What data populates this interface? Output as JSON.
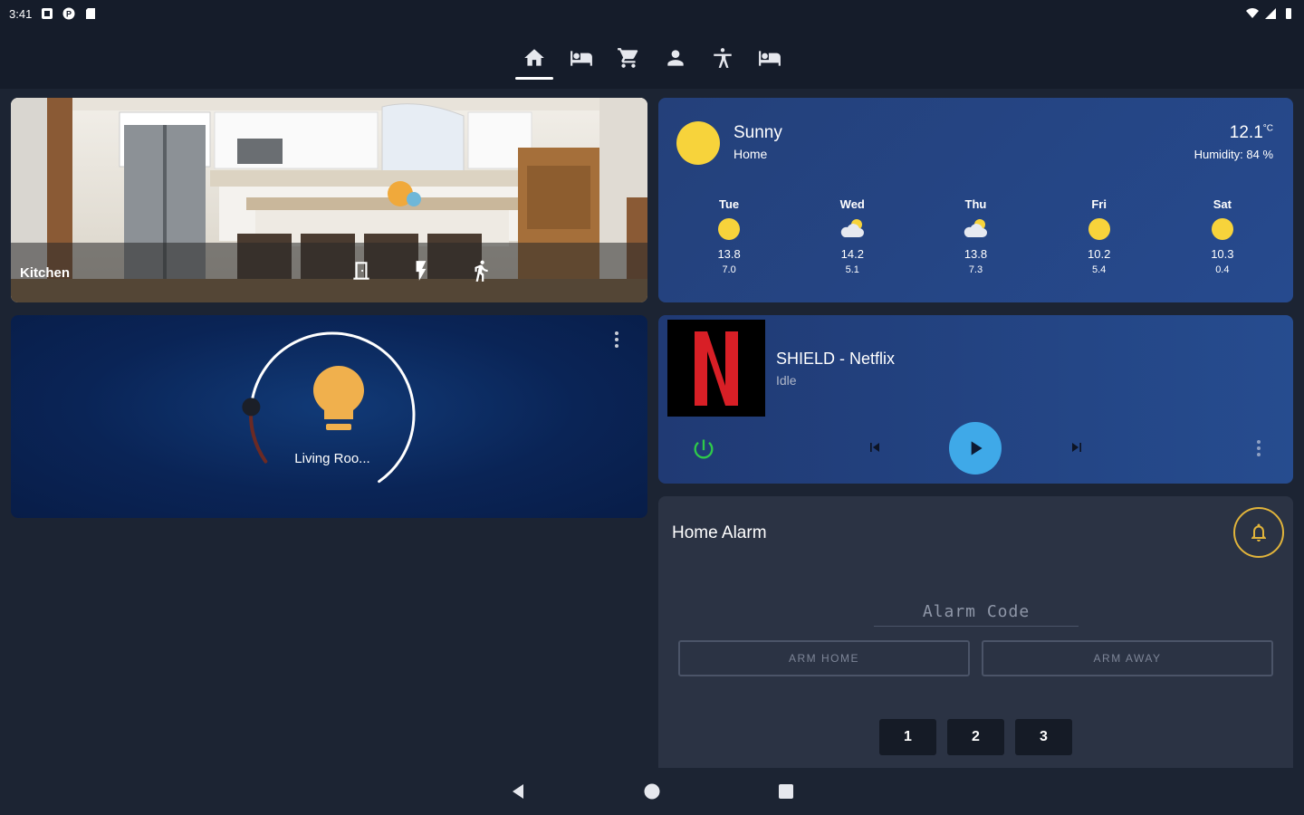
{
  "status_bar": {
    "time": "3:41"
  },
  "nav_tabs": [
    {
      "icon": "home-icon",
      "active": true
    },
    {
      "icon": "bed-icon",
      "active": false
    },
    {
      "icon": "cart-icon",
      "active": false
    },
    {
      "icon": "person-icon",
      "active": false
    },
    {
      "icon": "figure-icon",
      "active": false
    },
    {
      "icon": "bed-icon",
      "active": false
    }
  ],
  "kitchen": {
    "title": "Kitchen",
    "icons": [
      "door-icon",
      "flash-icon",
      "walk-icon"
    ]
  },
  "weather": {
    "condition": "Sunny",
    "location": "Home",
    "temperature": "12.1",
    "unit": "°C",
    "humidity": "Humidity: 84 %",
    "forecast": [
      {
        "day": "Tue",
        "icon": "sun-icon",
        "high": "13.8",
        "low": "7.0"
      },
      {
        "day": "Wed",
        "icon": "partly-cloudy-icon",
        "high": "14.2",
        "low": "5.1"
      },
      {
        "day": "Thu",
        "icon": "partly-cloudy-icon",
        "high": "13.8",
        "low": "7.3"
      },
      {
        "day": "Fri",
        "icon": "sun-icon",
        "high": "10.2",
        "low": "5.4"
      },
      {
        "day": "Sat",
        "icon": "sun-icon",
        "high": "10.3",
        "low": "0.4"
      }
    ]
  },
  "light": {
    "name": "Living Roo...",
    "brightness_fraction": 0.15
  },
  "media": {
    "title": "SHIELD - Netflix",
    "state": "Idle",
    "artwork_letter": "N"
  },
  "alarm": {
    "title": "Home Alarm",
    "code_placeholder": "Alarm Code",
    "arm_home": "ARM HOME",
    "arm_away": "ARM AWAY",
    "keys": [
      "1",
      "2",
      "3"
    ]
  },
  "colors": {
    "accent": "#3fa9e8",
    "sun": "#f7d33b",
    "bell": "#e1b43b",
    "power": "#2ec94a"
  }
}
